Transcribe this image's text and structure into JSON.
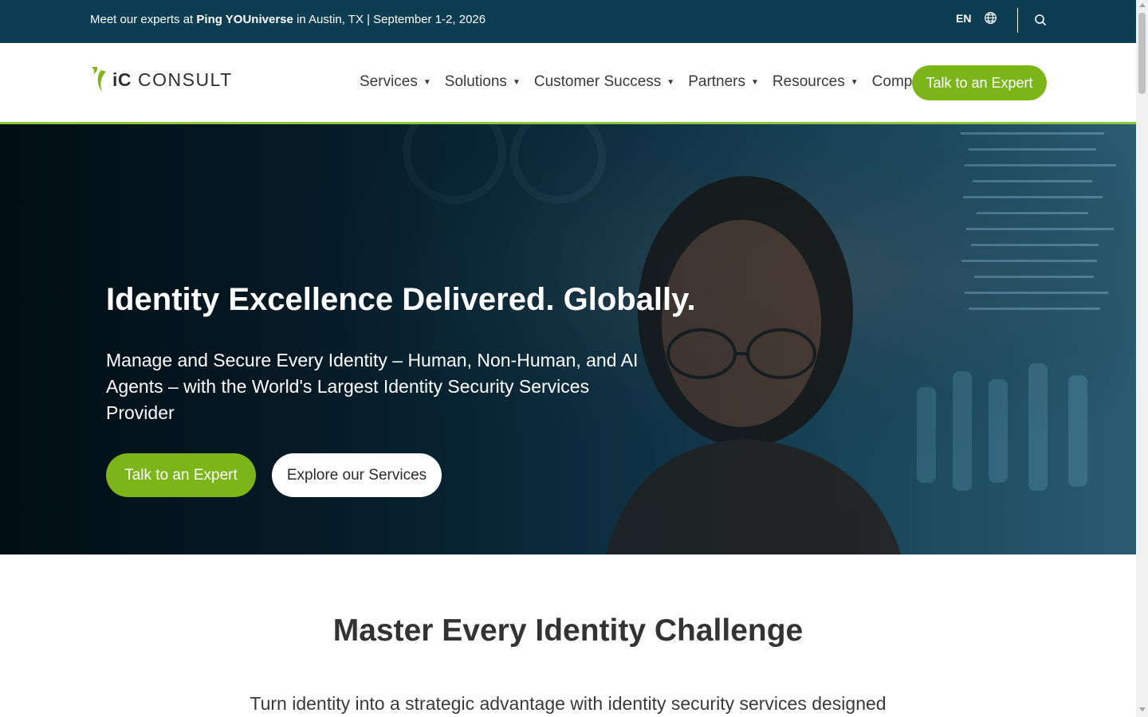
{
  "topbar": {
    "announce_prefix": "Meet our experts at ",
    "announce_event": "Ping YOUniverse",
    "announce_suffix": " in Austin, TX | September 1-2, 2026",
    "language": "EN",
    "globe_icon": "globe-icon",
    "search_icon": "search-icon"
  },
  "header": {
    "logo_ic": "iC",
    "logo_consult": "CONSULT",
    "nav": [
      {
        "label": "Services"
      },
      {
        "label": "Solutions"
      },
      {
        "label": "Customer Success"
      },
      {
        "label": "Partners"
      },
      {
        "label": "Resources"
      },
      {
        "label": "Company"
      }
    ],
    "cta": "Talk to an Expert"
  },
  "hero": {
    "title": "Identity Excellence Delivered. Globally.",
    "subtitle": "Manage and Secure Every Identity – Human, Non-Human, and AI Agents – with the World's Largest Identity Security Services Provider",
    "primary_button": "Talk to an Expert",
    "secondary_button": "Explore our Services"
  },
  "section": {
    "title": "Master Every Identity Challenge",
    "text": "Turn identity into a strategic advantage with identity security services designed"
  },
  "colors": {
    "topbar_bg": "#0c3d53",
    "brand_green": "#7cb518",
    "accent_line": "#8cc63f"
  }
}
